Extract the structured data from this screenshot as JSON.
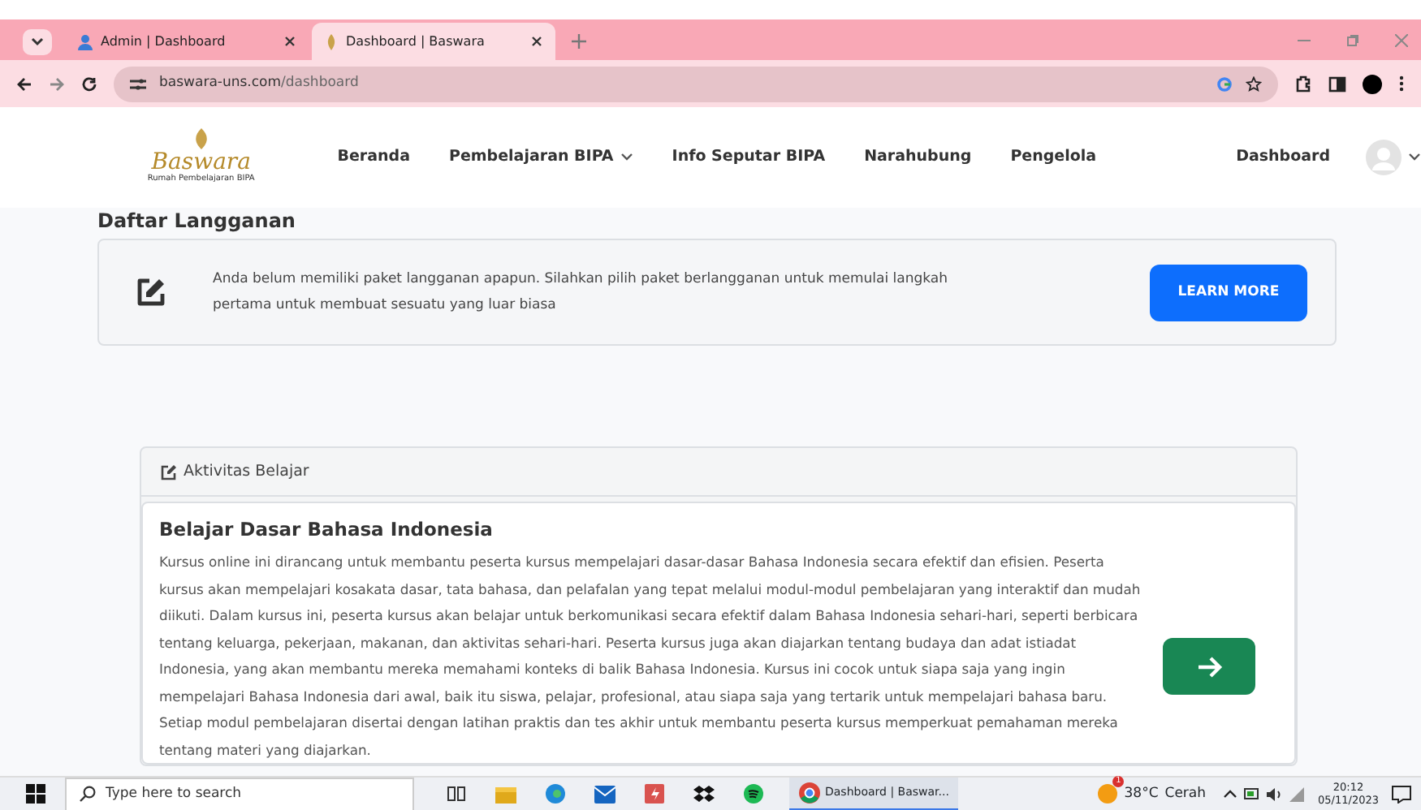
{
  "browser": {
    "tabs": [
      {
        "title": "Admin | Dashboard",
        "selected": false
      },
      {
        "title": "Dashboard | Baswara",
        "selected": true
      }
    ],
    "url_host": "baswara-uns.com",
    "url_path": "/dashboard"
  },
  "navbar": {
    "brand": "Baswara",
    "tagline": "Rumah Pembelajaran BIPA",
    "items": [
      {
        "label": "Beranda",
        "dropdown": false
      },
      {
        "label": "Pembelajaran BIPA",
        "dropdown": true
      },
      {
        "label": "Info Seputar BIPA",
        "dropdown": false
      },
      {
        "label": "Narahubung",
        "dropdown": false
      },
      {
        "label": "Pengelola",
        "dropdown": false
      },
      {
        "label": "Dashboard",
        "dropdown": false
      }
    ]
  },
  "subscription": {
    "heading": "Daftar Langganan",
    "message": "Anda belum memiliki paket langganan apapun. Silahkan pilih paket berlangganan untuk memulai langkah pertama untuk membuat sesuatu yang luar biasa",
    "button": "LEARN MORE"
  },
  "activity": {
    "header": "Aktivitas Belajar",
    "course_title": "Belajar Dasar Bahasa Indonesia",
    "description": "Kursus online ini dirancang untuk membantu peserta kursus mempelajari dasar-dasar Bahasa Indonesia secara efektif dan efisien. Peserta kursus akan mempelajari kosakata dasar, tata bahasa, dan pelafalan yang tepat melalui modul-modul pembelajaran yang interaktif dan mudah diikuti. Dalam kursus ini, peserta kursus akan belajar untuk berkomunikasi secara efektif dalam Bahasa Indonesia sehari-hari, seperti berbicara tentang keluarga, pekerjaan, makanan, dan aktivitas sehari-hari. Peserta kursus juga akan diajarkan tentang budaya dan adat istiadat Indonesia, yang akan membantu mereka memahami konteks di balik Bahasa Indonesia. Kursus ini cocok untuk siapa saja yang ingin mempelajari Bahasa Indonesia dari awal, baik itu siswa, pelajar, profesional, atau siapa saja yang tertarik untuk mempelajari bahasa baru. Setiap modul pembelajaran disertai dengan latihan praktis dan tes akhir untuk membantu peserta kursus memperkuat pemahaman mereka tentang materi yang diajarkan."
  },
  "taskbar": {
    "search_placeholder": "Type here to search",
    "window": "Dashboard | Baswar...",
    "weather_badge": "1",
    "temperature": "38°C",
    "weather": "Cerah",
    "time": "20:12",
    "date": "05/11/2023"
  }
}
